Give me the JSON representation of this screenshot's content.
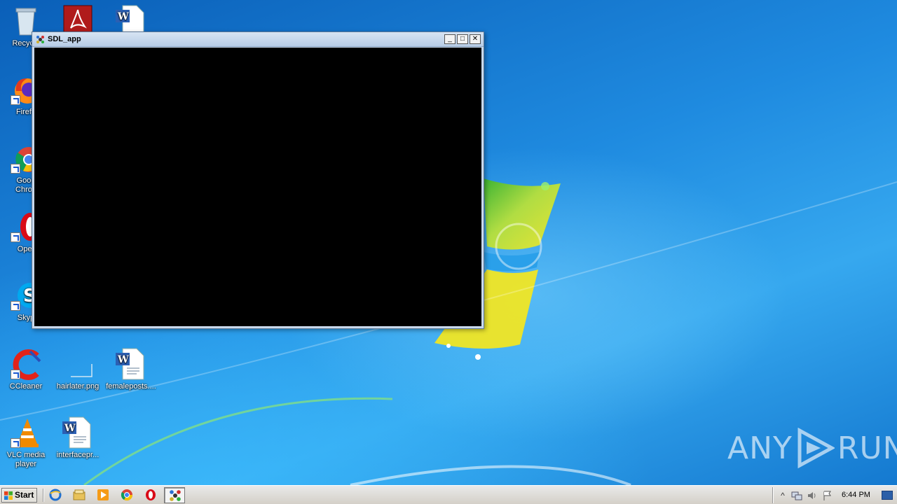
{
  "desktop_icons": [
    {
      "label": "Recycle",
      "icon": "recycle-bin-icon"
    },
    {
      "label": "",
      "icon": "acrobat-icon"
    },
    {
      "label": "",
      "icon": "word-doc-icon"
    },
    {
      "label": "Firefo",
      "icon": "firefox-icon"
    },
    {
      "label": "Goog\nChron",
      "icon": "chrome-icon"
    },
    {
      "label": "Oper",
      "icon": "opera-icon"
    },
    {
      "label": "Skyp",
      "icon": "skype-icon"
    },
    {
      "label": "CCleaner",
      "icon": "ccleaner-icon"
    },
    {
      "label": "hairlater.png",
      "icon": "image-file-icon"
    },
    {
      "label": "femaleposts....",
      "icon": "word-doc-icon"
    },
    {
      "label": "VLC media\nplayer",
      "icon": "vlc-icon"
    },
    {
      "label": "interfacepr...",
      "icon": "word-doc-icon"
    }
  ],
  "window": {
    "title": "SDL_app",
    "minimize_glyph": "_",
    "maximize_glyph": "□",
    "close_glyph": "✕"
  },
  "watermark": {
    "left": "ANY",
    "right": "RUN"
  },
  "taskbar": {
    "start_label": "Start",
    "clock": "6:44 PM",
    "quick_launch": [
      "ie-icon",
      "explorer-icon",
      "media-player-icon",
      "chrome-icon",
      "opera-icon"
    ],
    "active_task_icon": "sdl-app-icon"
  },
  "colors": {
    "desktop_blue": "#1a7fd4",
    "taskbar": "#d4d0c8",
    "window_client": "#000000"
  }
}
